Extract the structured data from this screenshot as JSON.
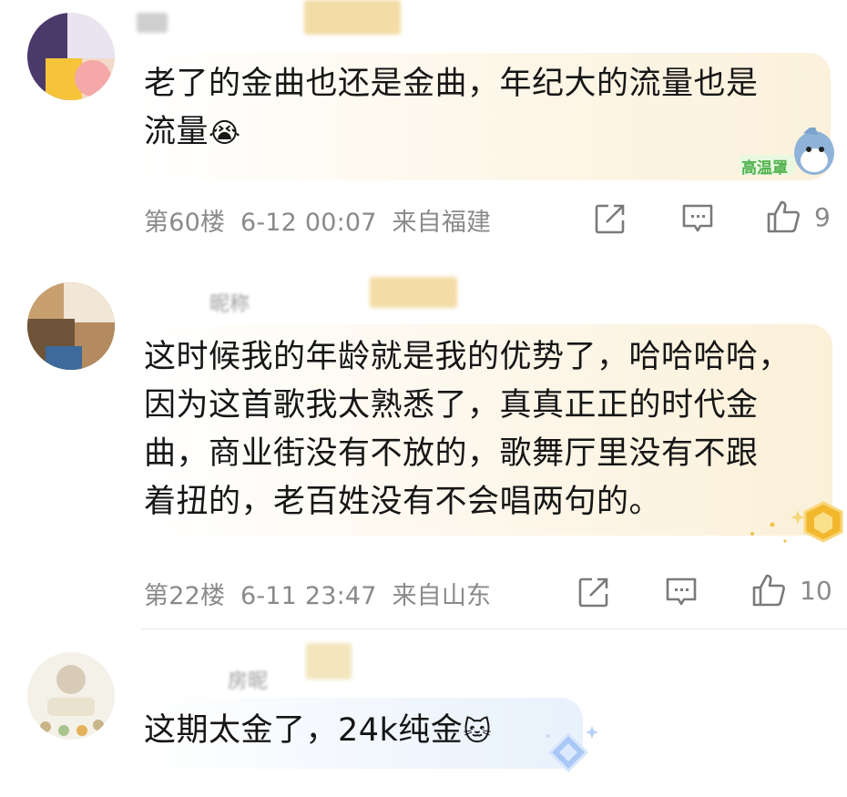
{
  "comments": [
    {
      "text_line1": "老了的金曲也还是金曲，年纪大的流量也是",
      "text_line2": "流量",
      "emoji": "😭",
      "floor": "第60楼",
      "time": "6-12 00:07",
      "location": "来自福建",
      "likes": "9",
      "badge_text": "高温罩"
    },
    {
      "name_visible": "昵称",
      "text_line1": "这时候我的年龄就是我的优势了，哈哈哈哈，",
      "text_line2": "因为这首歌我太熟悉了，真真正正的时代金",
      "text_line3": "曲，商业街没有不放的，歌舞厅里没有不跟",
      "text_line4": "着扭的，老百姓没有不会唱两句的。",
      "floor": "第22楼",
      "time": "6-11 23:47",
      "location": "来自山东",
      "likes": "10"
    },
    {
      "name_visible": "房昵",
      "text_line1": "这期太金了，24k纯金",
      "emoji": "🐱"
    }
  ],
  "colors": {
    "meta_gray": "#8a8a8a",
    "bubble_warm": "#fdf7ea",
    "bubble_blue": "#eef5fd"
  }
}
